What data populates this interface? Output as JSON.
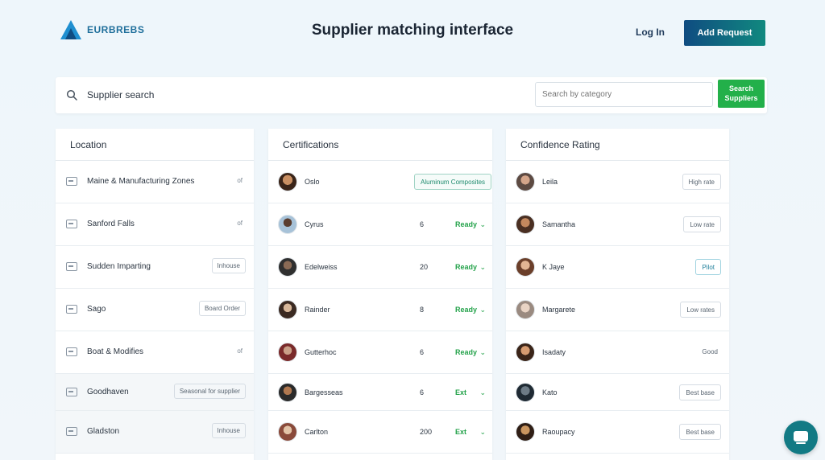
{
  "header": {
    "logo_text": "EURBREBS",
    "title": "Supplier matching interface",
    "login_label": "Log In",
    "cta_label": "Add Request"
  },
  "search": {
    "label": "Supplier search",
    "filter_placeholder": "Search by category",
    "button_label": "Search Suppliers"
  },
  "location_panel": {
    "title": "Location",
    "rows": [
      {
        "label": "Maine & Manufacturing Zones",
        "tag": "",
        "mark": "of"
      },
      {
        "label": "Sanford Falls",
        "tag": "",
        "mark": "of"
      },
      {
        "label": "Sudden Imparting",
        "tag": "Inhouse",
        "mark": ""
      },
      {
        "label": "Sago",
        "tag": "Board Order",
        "mark": ""
      },
      {
        "label": "Boat & Modifies",
        "tag": "",
        "mark": "of"
      },
      {
        "label": "Goodhaven",
        "tag": "Seasonal for supplier",
        "mark": ""
      },
      {
        "label": "Gladston",
        "tag": "Inhouse",
        "mark": ""
      }
    ]
  },
  "certs_panel": {
    "title": "Certifications",
    "rows": [
      {
        "name": "Oslo",
        "count": "",
        "status": "",
        "badge": "Aluminum Composites"
      },
      {
        "name": "Cyrus",
        "count": "6",
        "status": "Ready",
        "badge": ""
      },
      {
        "name": "Edelweiss",
        "count": "20",
        "status": "Ready",
        "badge": ""
      },
      {
        "name": "Rainder",
        "count": "8",
        "status": "Ready",
        "badge": ""
      },
      {
        "name": "Gutterhoc",
        "count": "6",
        "status": "Ready",
        "badge": ""
      },
      {
        "name": "Bargesseas",
        "count": "6",
        "status": "Ext",
        "badge": ""
      },
      {
        "name": "Carlton",
        "count": "200",
        "status": "Ext",
        "badge": ""
      }
    ]
  },
  "confidence_panel": {
    "title": "Confidence Rating",
    "rows": [
      {
        "name": "Leila",
        "tag": "High rate",
        "style": "box"
      },
      {
        "name": "Samantha",
        "tag": "Low rate",
        "style": "box"
      },
      {
        "name": "K Jaye",
        "tag": "Pilot",
        "style": "accent"
      },
      {
        "name": "Margarete",
        "tag": "Low rates",
        "style": "box"
      },
      {
        "name": "Isadaty",
        "tag": "Good",
        "style": "plain"
      },
      {
        "name": "Kato",
        "tag": "Best base",
        "style": "box"
      },
      {
        "name": "Raoupacy",
        "tag": "Best base",
        "style": "box"
      }
    ]
  },
  "icons": {
    "search": "search-icon",
    "location_row": "building-icon",
    "chevron": "chevron-down-icon",
    "chat": "chat-icon"
  },
  "colors": {
    "brand_blue": "#0f4c81",
    "brand_teal": "#11897f",
    "success_green": "#23b04a",
    "fab": "#127a84"
  }
}
